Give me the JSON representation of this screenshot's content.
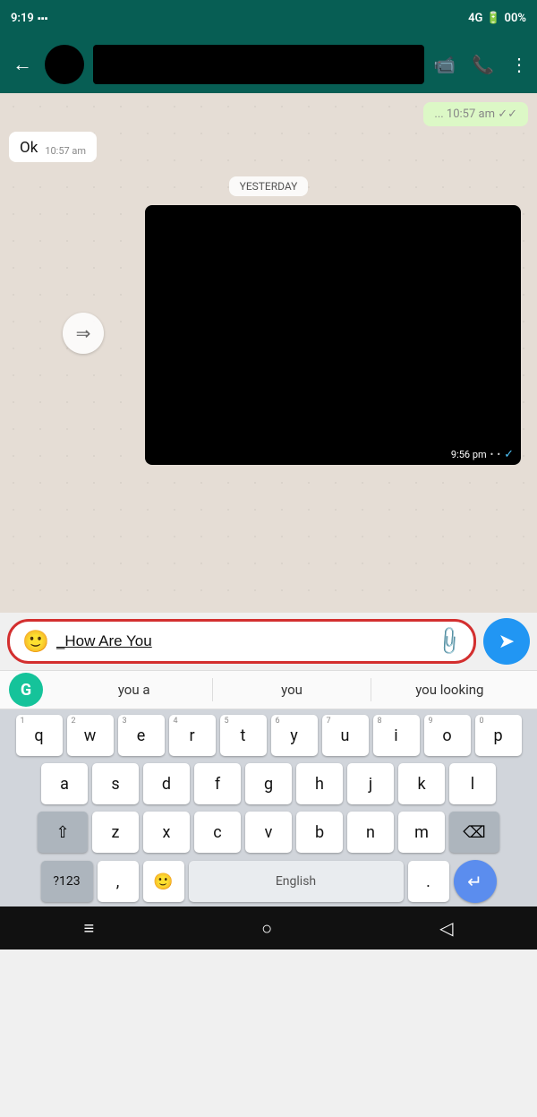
{
  "status_bar": {
    "time": "9:19",
    "signal": "4G",
    "battery": "00%"
  },
  "header": {
    "back_label": "←",
    "video_icon": "📹",
    "phone_icon": "📞",
    "more_icon": "⋮"
  },
  "chat": {
    "msg_ok_text": "Ok",
    "msg_ok_time": "10:57 am",
    "date_separator": "YESTERDAY",
    "video_time": "9:56 pm"
  },
  "input": {
    "emoji_icon": "🙂",
    "text_value": "_How Are You",
    "attach_icon": "📎",
    "send_icon": "➤"
  },
  "suggestions": {
    "grammarly_label": "G",
    "items": [
      "you a",
      "you",
      "you looking"
    ]
  },
  "keyboard": {
    "row1": [
      {
        "char": "q",
        "num": "1"
      },
      {
        "char": "w",
        "num": "2"
      },
      {
        "char": "e",
        "num": "3"
      },
      {
        "char": "r",
        "num": "4"
      },
      {
        "char": "t",
        "num": "5"
      },
      {
        "char": "y",
        "num": "6"
      },
      {
        "char": "u",
        "num": "7"
      },
      {
        "char": "i",
        "num": "8"
      },
      {
        "char": "o",
        "num": "9"
      },
      {
        "char": "p",
        "num": "0"
      }
    ],
    "row2": [
      {
        "char": "a"
      },
      {
        "char": "s"
      },
      {
        "char": "d"
      },
      {
        "char": "f"
      },
      {
        "char": "g"
      },
      {
        "char": "h"
      },
      {
        "char": "j"
      },
      {
        "char": "k"
      },
      {
        "char": "l"
      }
    ],
    "row3": [
      {
        "char": "z"
      },
      {
        "char": "x"
      },
      {
        "char": "c"
      },
      {
        "char": "v"
      },
      {
        "char": "b"
      },
      {
        "char": "n"
      },
      {
        "char": "m"
      }
    ],
    "bottom_row": {
      "symbols_label": "?123",
      "comma_label": ",",
      "emoji_label": "🙂",
      "space_label": "English",
      "period_label": ".",
      "enter_label": "↵"
    }
  },
  "nav_bar": {
    "home_icon": "≡",
    "circle_icon": "○",
    "back_icon": "◁"
  }
}
